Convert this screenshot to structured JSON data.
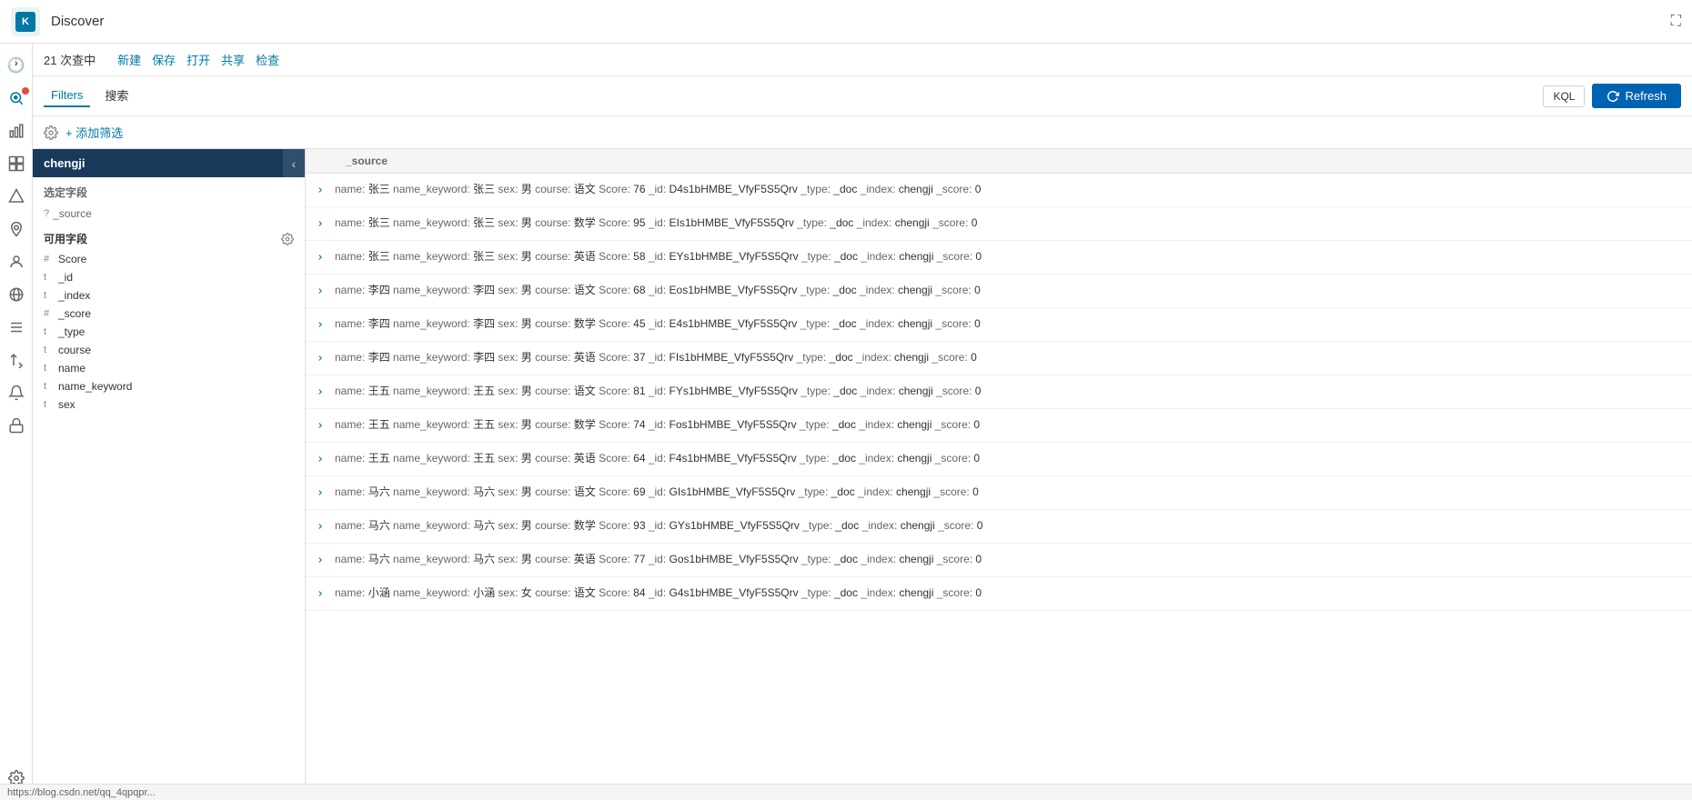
{
  "topbar": {
    "logo_text": "K",
    "title": "Discover",
    "fullscreen_icon": "⛶"
  },
  "second_bar": {
    "count": "21 次查中",
    "buttons": [
      "新建",
      "保存",
      "打开",
      "共享",
      "检查"
    ]
  },
  "filter_bar": {
    "filters_tab": "Filters",
    "search_tab": "搜索",
    "kql_label": "KQL",
    "refresh_label": "Refresh"
  },
  "gear_bar": {
    "add_filter": "+ 添加筛选"
  },
  "left_panel": {
    "index_name": "chengji",
    "selected_fields_label": "选定字段",
    "source_field": "? _source",
    "available_fields_label": "可用字段",
    "fields": [
      {
        "type": "#",
        "name": "Score"
      },
      {
        "type": "t",
        "name": "_id"
      },
      {
        "type": "t",
        "name": "_index"
      },
      {
        "type": "#",
        "name": "_score"
      },
      {
        "type": "t",
        "name": "_type"
      },
      {
        "type": "t",
        "name": "course"
      },
      {
        "type": "t",
        "name": "name"
      },
      {
        "type": "t",
        "name": "name_keyword"
      },
      {
        "type": "t",
        "name": "sex"
      }
    ]
  },
  "results_header": "_source",
  "rows": [
    "name: 张三  name_keyword: 张三  sex: 男  course: 语文  Score: 76  _id: D4s1bHMBE_VfyF5S5Qrv  _type: _doc  _index: chengji  _score: 0",
    "name: 张三  name_keyword: 张三  sex: 男  course: 数学  Score: 95  _id: EIs1bHMBE_VfyF5S5Qrv  _type: _doc  _index: chengji  _score: 0",
    "name: 张三  name_keyword: 张三  sex: 男  course: 英语  Score: 58  _id: EYs1bHMBE_VfyF5S5Qrv  _type: _doc  _index: chengji  _score: 0",
    "name: 李四  name_keyword: 李四  sex: 男  course: 语文  Score: 68  _id: Eos1bHMBE_VfyF5S5Qrv  _type: _doc  _index: chengji  _score: 0",
    "name: 李四  name_keyword: 李四  sex: 男  course: 数学  Score: 45  _id: E4s1bHMBE_VfyF5S5Qrv  _type: _doc  _index: chengji  _score: 0",
    "name: 李四  name_keyword: 李四  sex: 男  course: 英语  Score: 37  _id: FIs1bHMBE_VfyF5S5Qrv  _type: _doc  _index: chengji  _score: 0",
    "name: 王五  name_keyword: 王五  sex: 男  course: 语文  Score: 81  _id: FYs1bHMBE_VfyF5S5Qrv  _type: _doc  _index: chengji  _score: 0",
    "name: 王五  name_keyword: 王五  sex: 男  course: 数学  Score: 74  _id: Fos1bHMBE_VfyF5S5Qrv  _type: _doc  _index: chengji  _score: 0",
    "name: 王五  name_keyword: 王五  sex: 男  course: 英语  Score: 64  _id: F4s1bHMBE_VfyF5S5Qrv  _type: _doc  _index: chengji  _score: 0",
    "name: 马六  name_keyword: 马六  sex: 男  course: 语文  Score: 69  _id: GIs1bHMBE_VfyF5S5Qrv  _type: _doc  _index: chengji  _score: 0",
    "name: 马六  name_keyword: 马六  sex: 男  course: 数学  Score: 93  _id: GYs1bHMBE_VfyF5S5Qrv  _type: _doc  _index: chengji  _score: 0",
    "name: 马六  name_keyword: 马六  sex: 男  course: 英语  Score: 77  _id: Gos1bHMBE_VfyF5S5Qrv  _type: _doc  _index: chengji  _score: 0",
    "name: 小涵  name_keyword: 小涵  sex: 女  course: 语文  Score: 84  _id: G4s1bHMBE_VfyF5S5Qrv  _type: _doc  _index: chengji  _score: 0"
  ],
  "url_bar": "https://blog.csdn.net/qq_4qpqpr..."
}
